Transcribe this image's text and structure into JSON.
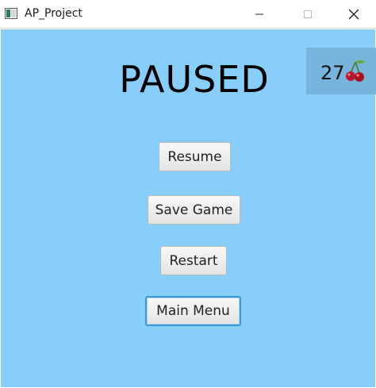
{
  "window": {
    "title": "AP_Project",
    "icon": "app-window-icon",
    "controls": [
      "minimize-icon",
      "maximize-icon",
      "close-icon"
    ]
  },
  "pause_screen": {
    "title": "PAUSED",
    "background_color": "#87cefa",
    "score": {
      "value": "27",
      "icon": "cherry-icon"
    },
    "buttons": {
      "resume": "Resume",
      "save_game": "Save Game",
      "restart": "Restart",
      "main_menu": "Main Menu"
    },
    "focused_button": "main_menu"
  }
}
